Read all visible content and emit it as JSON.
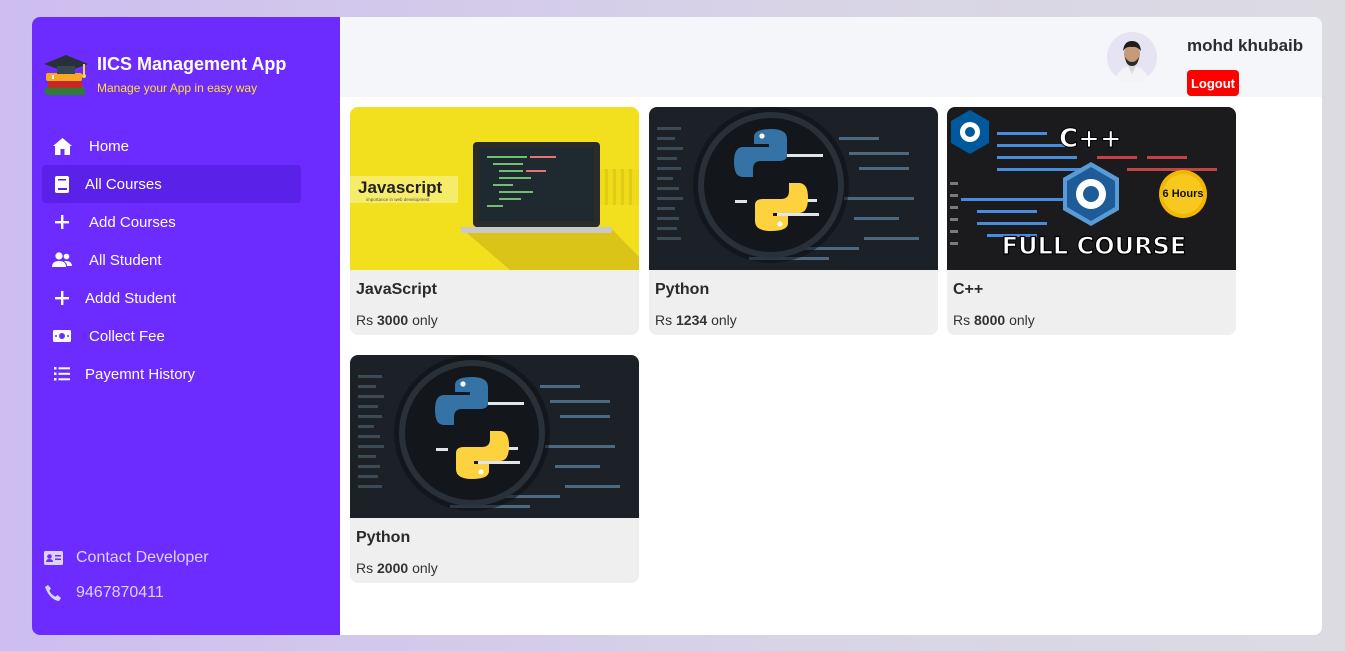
{
  "brand": {
    "title": "IICS Management App",
    "subtitle": "Manage your App in easy way"
  },
  "sidebar": {
    "items": [
      {
        "label": "Home",
        "icon": "home-icon"
      },
      {
        "label": "All Courses",
        "icon": "book-icon",
        "active": true
      },
      {
        "label": "Add Courses",
        "icon": "plus-icon"
      },
      {
        "label": "All Student",
        "icon": "users-icon"
      },
      {
        "label": "Addd Student",
        "icon": "plus-icon"
      },
      {
        "label": "Collect Fee",
        "icon": "money-icon"
      },
      {
        "label": "Payemnt History",
        "icon": "list-icon"
      }
    ],
    "footer": {
      "contact_label": "Contact Developer",
      "phone": "9467870411"
    }
  },
  "header": {
    "username": "mohd khubaib",
    "logout_label": "Logout"
  },
  "courses": [
    {
      "title": "JavaScript",
      "currency": "Rs",
      "price": "3000",
      "suffix": "only",
      "thumb_text": "Javascript",
      "thumb_sub": "importance in web development"
    },
    {
      "title": "Python",
      "currency": "Rs",
      "price": "1234",
      "suffix": "only"
    },
    {
      "title": "C++",
      "currency": "Rs",
      "price": "8000",
      "suffix": "only",
      "thumb_text": "FULL COURSE",
      "thumb_badge": "6 Hours",
      "thumb_logo": "C++"
    },
    {
      "title": "Python",
      "currency": "Rs",
      "price": "2000",
      "suffix": "only"
    }
  ],
  "colors": {
    "sidebar": "#6c2bff",
    "active": "#5a21e8",
    "accent": "#ffe033",
    "logout": "#ff0000"
  }
}
